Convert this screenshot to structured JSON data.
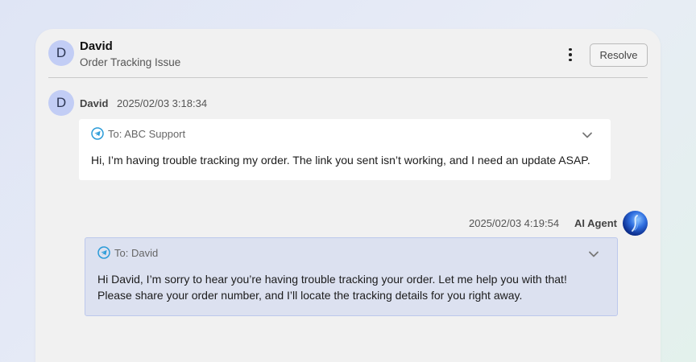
{
  "header": {
    "avatar_letter": "D",
    "name": "David",
    "subject": "Order Tracking Issue",
    "resolve_label": "Resolve"
  },
  "messages": [
    {
      "avatar_letter": "D",
      "sender": "David",
      "timestamp": "2025/02/03 3:18:34",
      "to": "To: ABC Support",
      "body": "Hi, I’m having trouble tracking my order. The link you sent isn’t working, and I need an update ASAP."
    },
    {
      "sender": "AI Agent",
      "timestamp": "2025/02/03 4:19:54",
      "to": "To: David",
      "body_line1": "Hi David, I’m sorry to hear you’re having trouble tracking your order. Let me help you with that!",
      "body_line2": "Please share your order number, and I’ll locate the tracking details for you right away."
    }
  ],
  "icons": {
    "send": "telegram-send-icon",
    "chevron": "chevron-down-icon",
    "menu": "kebab-menu-icon"
  },
  "colors": {
    "accent_blue": "#2a9bd8",
    "agent_card_bg": "#dce1f0",
    "avatar_bg": "#c2cdf5"
  }
}
